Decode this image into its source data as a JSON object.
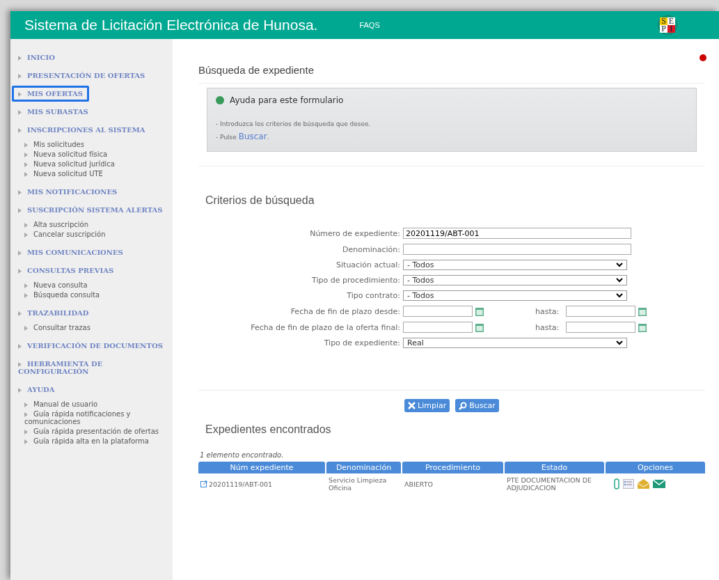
{
  "header": {
    "title": "Sistema de Licitación Electrónica de Hunosa.",
    "link": "FAQS",
    "logo": [
      "S",
      "E",
      "P",
      "I"
    ]
  },
  "sidebar": {
    "items": [
      {
        "label": "INICIO",
        "highlighted": false
      },
      {
        "label": "PRESENTACIÓN DE OFERTAS",
        "highlighted": false
      },
      {
        "label": "MIS OFERTAS",
        "highlighted": true
      },
      {
        "label": "MIS SUBASTAS",
        "highlighted": false
      },
      {
        "label": "INSCRIPCIONES AL SISTEMA",
        "highlighted": false,
        "children": [
          "Mis solicitudes",
          "Nueva solicitud física",
          "Nueva solicitud jurídica",
          "Nueva solicitud UTE"
        ]
      },
      {
        "label": "MIS NOTIFICACIONES",
        "highlighted": false
      },
      {
        "label": "SUSCRIPCIÓN SISTEMA ALERTAS",
        "highlighted": false,
        "children": [
          "Alta suscripción",
          "Cancelar suscripción"
        ]
      },
      {
        "label": "MIS COMUNICACIONES",
        "highlighted": false
      },
      {
        "label": "CONSULTAS PREVIAS",
        "highlighted": false,
        "children": [
          "Nueva consulta",
          "Búsqueda consulta"
        ]
      },
      {
        "label": "TRAZABILIDAD",
        "highlighted": false,
        "children": [
          "Consultar trazas"
        ]
      },
      {
        "label": "VERIFICACIÓN DE DOCUMENTOS",
        "highlighted": false
      },
      {
        "label": "HERRAMIENTA DE CONFIGURACIÓN",
        "highlighted": false
      },
      {
        "label": "AYUDA",
        "highlighted": false,
        "children": [
          "Manual de usuario",
          "Guía rápida notificaciones y comunicaciones",
          "Guía rápida presentación de ofertas",
          "Guía rápida alta en la plataforma"
        ]
      }
    ]
  },
  "page_title": "Búsqueda de expediente",
  "help": {
    "title": "Ayuda para este formulario",
    "lines": [
      "- Introduzca los criterios de búsqueda que desee.",
      "- Pulse "
    ],
    "link": "Buscar",
    "link_suffix": "."
  },
  "criteria": {
    "title": "Criterios de búsqueda",
    "fields": [
      {
        "kind": "text",
        "label": "Número de expediente:",
        "value": "20201119/ABT-001"
      },
      {
        "kind": "text",
        "label": "Denominación:"
      },
      {
        "kind": "select",
        "label": "Situación actual:",
        "value": "- Todos"
      },
      {
        "kind": "select",
        "label": "Tipo de procedimiento:",
        "value": "- Todos"
      },
      {
        "kind": "select",
        "label": "Tipo contrato:",
        "value": "- Todos"
      },
      {
        "kind": "daterange",
        "label": "Fecha de fin de plazo desde:",
        "to_label": "hasta:"
      },
      {
        "kind": "daterange",
        "label": "Fecha de fin de plazo de la oferta final:",
        "to_label": "hasta:"
      },
      {
        "kind": "select",
        "label": "Tipo de expediente:",
        "value": "Real"
      }
    ]
  },
  "buttons": [
    {
      "kind": "clear",
      "label": "Limpiar"
    },
    {
      "kind": "search",
      "label": "Buscar"
    }
  ],
  "results": {
    "title": "Expedientes encontrados",
    "count": "1 elemento encontrado.",
    "columns": [
      "Núm expediente",
      "Denominación",
      "Procedimiento",
      "Estado",
      "Opciones"
    ],
    "rows": [
      {
        "cells": [
          "20201119/ABT-001",
          "Servicio Limpieza Oficina",
          "ABIERTO",
          "PTE DOCUMENTACION DE ADJUDICACION"
        ]
      }
    ]
  }
}
